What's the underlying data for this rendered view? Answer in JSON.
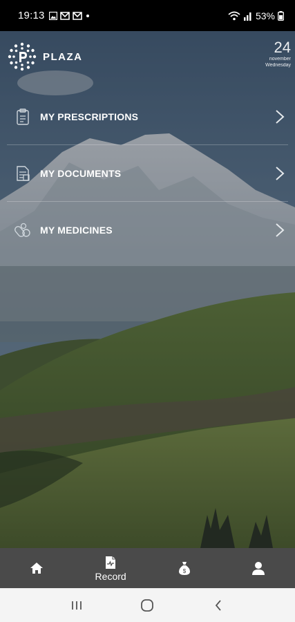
{
  "status_bar": {
    "time": "19:13",
    "battery": "53%",
    "left_icons": [
      "gallery-icon",
      "mail-icon",
      "mail-icon",
      "dot-icon"
    ],
    "right_icons": [
      "wifi-icon",
      "signal-icon",
      "battery-icon"
    ]
  },
  "header": {
    "app_name": "PLAZA",
    "date_day": "24",
    "date_month": "november",
    "date_weekday": "Wednesday"
  },
  "menu": {
    "items": [
      {
        "label": "MY PRESCRIPTIONS",
        "icon": "prescription-icon"
      },
      {
        "label": "MY DOCUMENTS",
        "icon": "document-icon"
      },
      {
        "label": "MY MEDICINES",
        "icon": "pills-icon"
      }
    ]
  },
  "bottom_nav": {
    "items": [
      {
        "label": "",
        "icon": "home-icon"
      },
      {
        "label": "Record",
        "icon": "record-icon",
        "active": true
      },
      {
        "label": "",
        "icon": "money-bag-icon"
      },
      {
        "label": "",
        "icon": "profile-icon"
      }
    ]
  },
  "system_nav": {
    "items": [
      "recents-button",
      "home-button",
      "back-button"
    ]
  }
}
